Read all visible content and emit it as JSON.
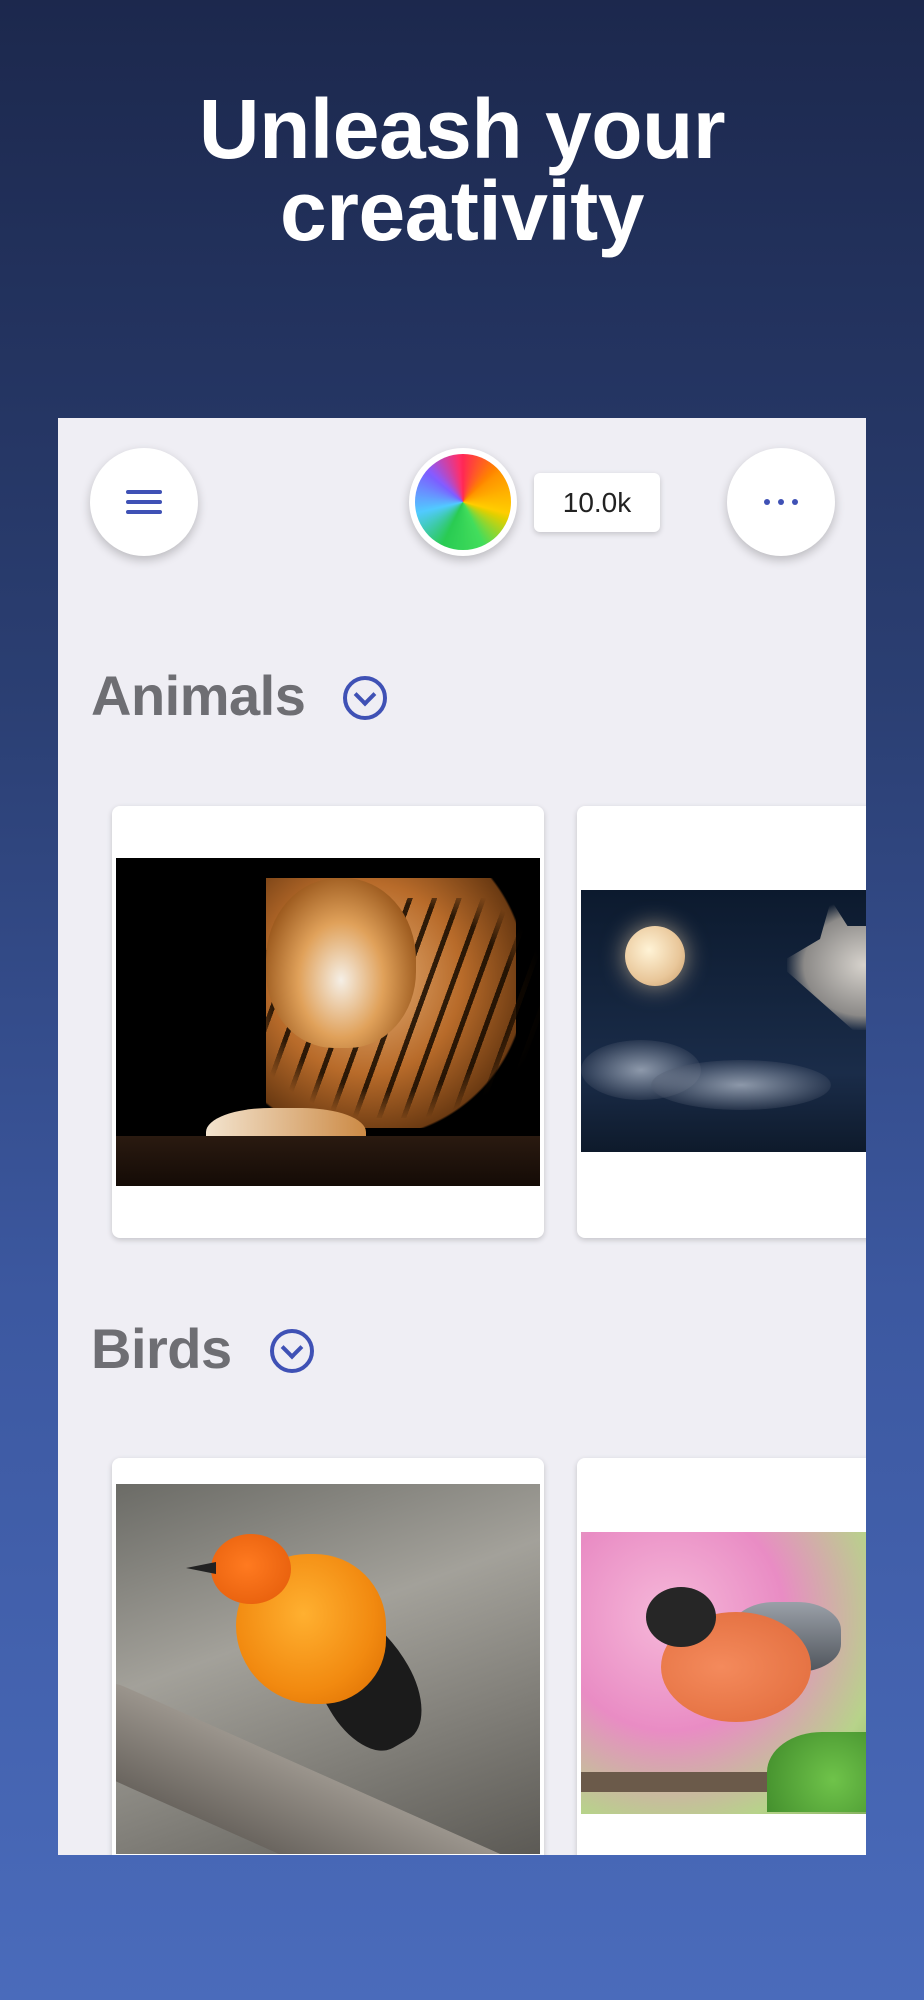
{
  "header": {
    "line1": "Unleash your",
    "line2": "creativity"
  },
  "toolbar": {
    "menu_icon": "hamburger-icon",
    "color_icon": "color-wheel-icon",
    "count": "10.0k",
    "more_icon": "more-horizontal-icon"
  },
  "sections": [
    {
      "title": "Animals",
      "toggle_icon": "chevron-down-circle-icon",
      "images": [
        "tiger",
        "moon-wolf"
      ]
    },
    {
      "title": "Birds",
      "toggle_icon": "chevron-down-circle-icon",
      "images": [
        "oriole",
        "bullfinch"
      ]
    }
  ],
  "colors": {
    "accent": "#3f51b5",
    "panel": "#efeef4",
    "section_title": "#6e6e73",
    "bg_top": "#1c284d",
    "bg_bottom": "#4a6bbb"
  }
}
